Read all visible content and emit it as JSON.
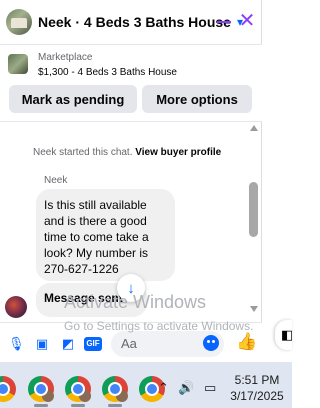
{
  "header": {
    "title": "Neek · 4 Beds 3 Baths House",
    "chevron": "▾",
    "minimize_icon": "minimize-icon",
    "close_icon": "close-icon"
  },
  "marketplace": {
    "label": "Marketplace",
    "listing": "$1,300 - 4 Beds 3 Baths House",
    "buttons": {
      "pending": "Mark as pending",
      "more": "More options"
    }
  },
  "conversation": {
    "system_text": "Neek started this chat.",
    "profile_link": "View buyer profile",
    "sender_name": "Neek",
    "messages": [
      "Is this still available and is there a good time to come take a look? My number is 270-627-1226",
      "Message sent"
    ]
  },
  "watermark": {
    "title": "Activate Windows",
    "subtitle": "Go to Settings to activate Windows."
  },
  "composer": {
    "placeholder": "Aa",
    "gif_label": "GIF"
  },
  "taskbar": {
    "time": "5:51 PM",
    "date": "3/17/2025"
  },
  "colors": {
    "accent": "#0866ff",
    "header_controls": "#8a3ffc",
    "bubble": "#f0f0f0",
    "taskbar": "#dfe6f1"
  }
}
